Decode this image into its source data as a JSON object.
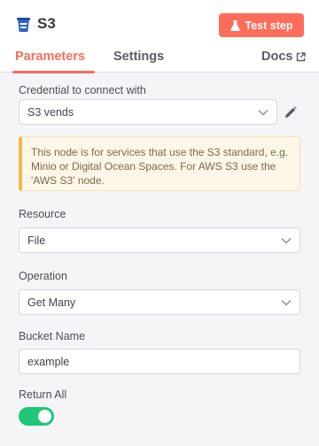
{
  "header": {
    "title": "S3",
    "node_icon": "bucket-icon",
    "test_button_label": "Test step",
    "accent_color": "#ff6d5a"
  },
  "tabs": {
    "parameters": "Parameters",
    "settings": "Settings",
    "docs": "Docs"
  },
  "credential": {
    "label": "Credential to connect with",
    "value": "S3 vends"
  },
  "notice": {
    "text": "This node is for services that use the S3 standard, e.g. Minio or Digital Ocean Spaces. For AWS S3 use the 'AWS S3' node."
  },
  "resource": {
    "label": "Resource",
    "value": "File"
  },
  "operation": {
    "label": "Operation",
    "value": "Get Many"
  },
  "bucket": {
    "label": "Bucket Name",
    "value": "example"
  },
  "return_all": {
    "label": "Return All",
    "enabled": true,
    "color": "#1fc776"
  }
}
